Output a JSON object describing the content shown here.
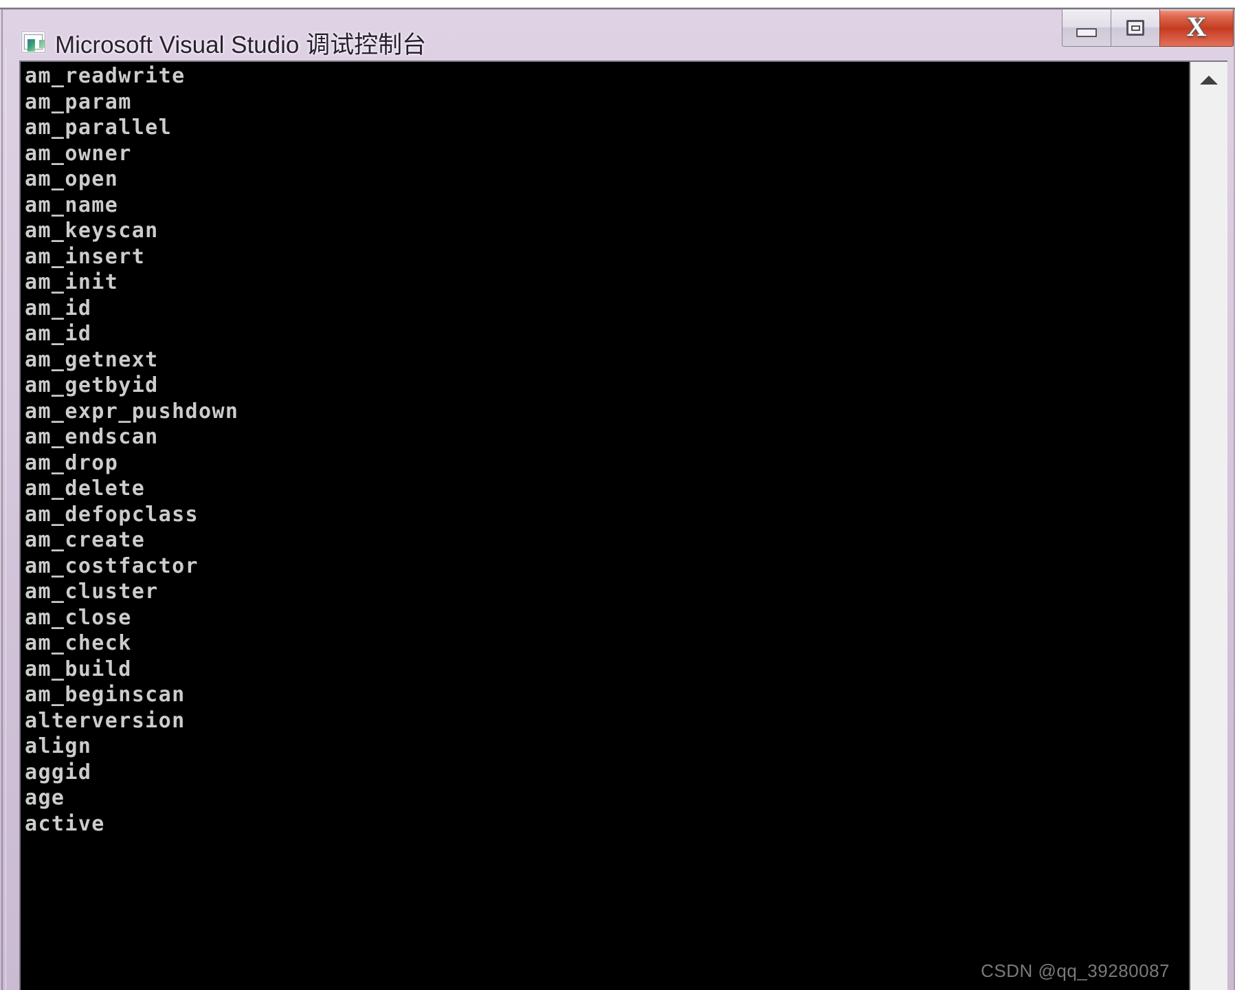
{
  "window": {
    "title": "Microsoft Visual Studio 调试控制台",
    "icon": "console-window-icon",
    "frame_color": "#d6c8dc",
    "controls": {
      "minimize_label": "",
      "maximize_label": "",
      "close_label": "X"
    }
  },
  "console": {
    "background_color": "#000000",
    "text_color": "#cccccc",
    "lines": [
      "am_readwrite",
      "am_param",
      "am_parallel",
      "am_owner",
      "am_open",
      "am_name",
      "am_keyscan",
      "am_insert",
      "am_init",
      "am_id",
      "am_id",
      "am_getnext",
      "am_getbyid",
      "am_expr_pushdown",
      "am_endscan",
      "am_drop",
      "am_delete",
      "am_defopclass",
      "am_create",
      "am_costfactor",
      "am_cluster",
      "am_close",
      "am_check",
      "am_build",
      "am_beginscan",
      "alterversion",
      "align",
      "aggid",
      "age",
      "active"
    ]
  },
  "scrollbar": {
    "up_arrow_icon": "chevron-up-icon",
    "position": "top"
  },
  "watermark": {
    "text": "CSDN @qq_39280087"
  }
}
